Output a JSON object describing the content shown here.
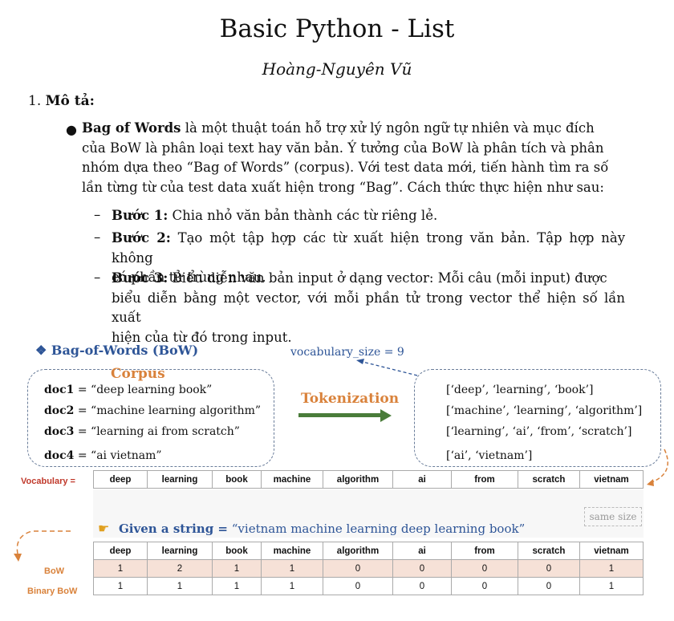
{
  "title": "Basic Python - List",
  "author": "Hoàng-Nguyên Vũ",
  "section": {
    "number": "1.",
    "heading": "Mô tả:"
  },
  "bullet": {
    "lead": "Bag of Words",
    "lines": [
      " là một thuật toán hỗ trợ xử lý ngôn ngữ tự nhiên và mục đích",
      "của BoW là phân loại text hay văn bản. Ý tưởng của BoW là phân tích và phân",
      "nhóm dựa theo “Bag of Words” (corpus). Với test data mới, tiến hành tìm ra số",
      "lần từng từ của test data xuất hiện trong “Bag”. Cách thức thực hiện như sau:"
    ]
  },
  "steps": [
    {
      "dash": "–",
      "label": "Bước 1:",
      "lines": [
        " Chia nhỏ văn bản thành các từ riêng lẻ."
      ]
    },
    {
      "dash": "–",
      "label": "Bước 2:",
      "lines": [
        " Tạo một tập hợp các từ xuất hiện trong văn bản. Tập hợp này không",
        "có phần tử trùng nhau."
      ]
    },
    {
      "dash": "–",
      "label": "Bước 3:",
      "lines": [
        " Biểu diễn văn bản input ở dạng vector: Mỗi câu (mỗi input) được",
        "biểu diễn bằng một vector, với mỗi phần tử trong vector thể hiện số lần xuất",
        "hiện của từ đó trong input."
      ]
    }
  ],
  "diagram": {
    "title": "❖ Bag-of-Words (BoW)",
    "vocab_size": "vocabulary_size = 9",
    "corpus_label": "Corpus",
    "docs": [
      {
        "name": "doc1",
        "text": " = “deep learning book”"
      },
      {
        "name": "doc2",
        "text": " = “machine learning algorithm”"
      },
      {
        "name": "doc3",
        "text": " = “learning ai from scratch”"
      },
      {
        "name": "doc4",
        "text": " = “ai vietnam”"
      }
    ],
    "tokenization_label": "Tokenization",
    "tokens": [
      "[‘deep’, ‘learning’, ‘book’]",
      "[‘machine’, ‘learning’, ‘algorithm’]",
      "[‘learning’, ‘ai’, ‘from’, ‘scratch’]",
      "[‘ai’, ‘vietnam’]"
    ],
    "vocabulary_label": "Vocabulary =",
    "vocabulary": [
      "deep",
      "learning",
      "book",
      "machine",
      "algorithm",
      "ai",
      "from",
      "scratch",
      "vietnam"
    ],
    "same_size": "same size",
    "given_label": "Given a string =",
    "given_value": " “vietnam machine learning deep learning book”",
    "bow_label": "BoW",
    "binary_label": "Binary BoW",
    "bow": [
      "1",
      "2",
      "1",
      "1",
      "0",
      "0",
      "0",
      "0",
      "1"
    ],
    "binary_bow": [
      "1",
      "1",
      "1",
      "1",
      "0",
      "0",
      "0",
      "0",
      "1"
    ],
    "colors": {
      "blue": "#2e5597",
      "orange": "#d9823b",
      "green": "#4a7c3a",
      "red": "#c0392b"
    }
  }
}
